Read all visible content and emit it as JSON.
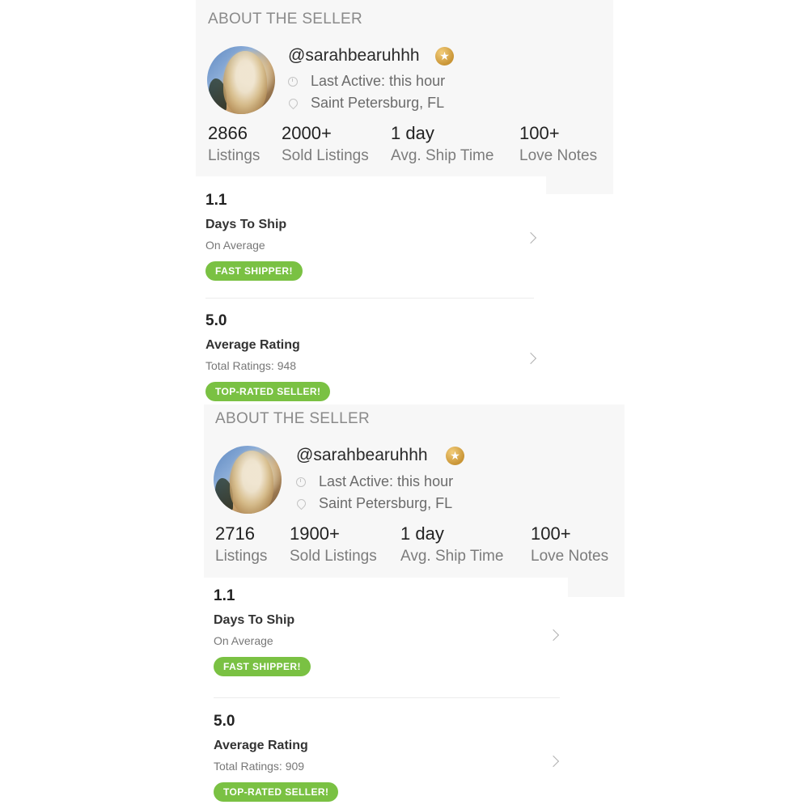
{
  "panels": [
    {
      "section_title": "ABOUT THE SELLER",
      "username": "@sarahbearuhhh",
      "badge_icon": "star-icon",
      "last_active": "Last Active: this hour",
      "location": "Saint Petersburg, FL",
      "stats": [
        {
          "value": "2866",
          "label": "Listings"
        },
        {
          "value": "2000+",
          "label": "Sold Listings"
        },
        {
          "value": "1 day",
          "label": "Avg. Ship Time"
        },
        {
          "value": "100+",
          "label": "Love Notes"
        }
      ],
      "shipping": {
        "value": "1.1",
        "title": "Days To Ship",
        "sub": "On Average",
        "badge": "FAST SHIPPER!"
      },
      "rating": {
        "value": "5.0",
        "title": "Average Rating",
        "sub": "Total Ratings: 948",
        "badge": "TOP-RATED SELLER!"
      }
    },
    {
      "section_title": "ABOUT THE SELLER",
      "username": "@sarahbearuhhh",
      "badge_icon": "star-icon",
      "last_active": "Last Active: this hour",
      "location": "Saint Petersburg, FL",
      "stats": [
        {
          "value": "2716",
          "label": "Listings"
        },
        {
          "value": "1900+",
          "label": "Sold Listings"
        },
        {
          "value": "1 day",
          "label": "Avg. Ship Time"
        },
        {
          "value": "100+",
          "label": "Love Notes"
        }
      ],
      "shipping": {
        "value": "1.1",
        "title": "Days To Ship",
        "sub": "On Average",
        "badge": "FAST SHIPPER!"
      },
      "rating": {
        "value": "5.0",
        "title": "Average Rating",
        "sub": "Total Ratings: 909",
        "badge": "TOP-RATED SELLER!"
      }
    }
  ],
  "colors": {
    "badge_green": "#7ac143",
    "gold_star": "#c99536",
    "header_bg": "#f7f7f7"
  }
}
